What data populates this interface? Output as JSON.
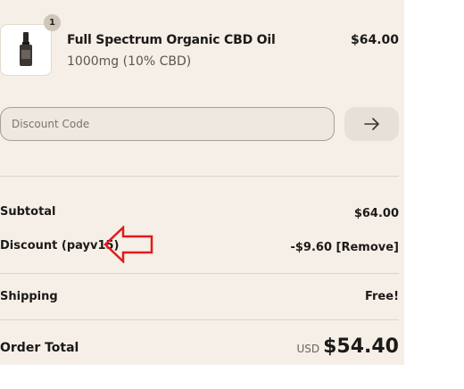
{
  "cart_item": {
    "quantity": "1",
    "name": "Full Spectrum Organic CBD Oil",
    "variant": "1000mg (10% CBD)",
    "price": "$64.00",
    "image_icon": "cbd-oil-bottle"
  },
  "discount": {
    "placeholder": "Discount Code",
    "apply_icon": "arrow-right"
  },
  "summary": {
    "subtotal_label": "Subtotal",
    "subtotal_value": "$64.00",
    "discount_label": "Discount (payv15)",
    "discount_value": "-$9.60",
    "remove_label": "[Remove]",
    "shipping_label": "Shipping",
    "shipping_value": "Free!",
    "total_label": "Order Total",
    "total_currency": "USD",
    "total_value": "$54.40"
  },
  "annotation": {
    "color": "#e01b1b",
    "icon": "left-arrow-outline"
  }
}
